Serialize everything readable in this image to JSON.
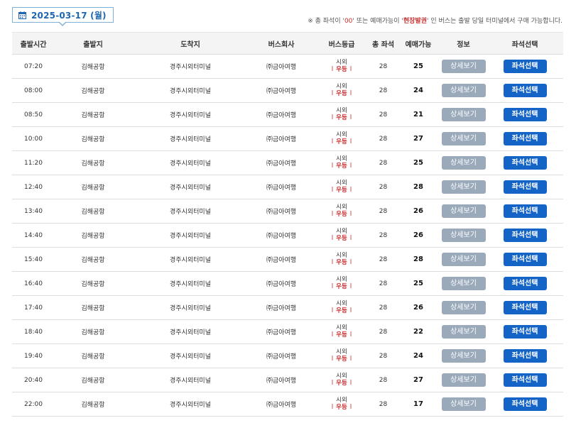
{
  "header": {
    "date": "2025-03-17 (월)",
    "notice_prefix": "※ 총 좌석이 '",
    "notice_zero": "00",
    "notice_middle": "' 또는 예매가능이 '",
    "notice_site": "현장발권",
    "notice_suffix": "' 인 버스는 출발 당일 터미널에서 구매 가능합니다."
  },
  "columns": [
    "출발시간",
    "출발지",
    "도착지",
    "버스회사",
    "버스등급",
    "총 좌석",
    "예매가능",
    "정보",
    "좌석선택"
  ],
  "grade_icon": "shiwoe-premium-grade-icon",
  "colors": {
    "accent": "#1464c8",
    "detail_button": "#9aaabb",
    "notice_highlight": "#cc2d2d"
  },
  "buttons": {
    "detail": "상세보기",
    "seat": "좌석선택"
  },
  "rows": [
    {
      "time": "07:20",
      "origin": "김해공항",
      "destination": "경주시외터미널",
      "company": "㈜금아여행",
      "grade": "시외우등",
      "total": "28",
      "available": "25"
    },
    {
      "time": "08:00",
      "origin": "김해공항",
      "destination": "경주시외터미널",
      "company": "㈜금아여행",
      "grade": "시외우등",
      "total": "28",
      "available": "24"
    },
    {
      "time": "08:50",
      "origin": "김해공항",
      "destination": "경주시외터미널",
      "company": "㈜금아여행",
      "grade": "시외우등",
      "total": "28",
      "available": "21"
    },
    {
      "time": "10:00",
      "origin": "김해공항",
      "destination": "경주시외터미널",
      "company": "㈜금아여행",
      "grade": "시외우등",
      "total": "28",
      "available": "27"
    },
    {
      "time": "11:20",
      "origin": "김해공항",
      "destination": "경주시외터미널",
      "company": "㈜금아여행",
      "grade": "시외우등",
      "total": "28",
      "available": "25"
    },
    {
      "time": "12:40",
      "origin": "김해공항",
      "destination": "경주시외터미널",
      "company": "㈜금아여행",
      "grade": "시외우등",
      "total": "28",
      "available": "28"
    },
    {
      "time": "13:40",
      "origin": "김해공항",
      "destination": "경주시외터미널",
      "company": "㈜금아여행",
      "grade": "시외우등",
      "total": "28",
      "available": "26"
    },
    {
      "time": "14:40",
      "origin": "김해공항",
      "destination": "경주시외터미널",
      "company": "㈜금아여행",
      "grade": "시외우등",
      "total": "28",
      "available": "26"
    },
    {
      "time": "15:40",
      "origin": "김해공항",
      "destination": "경주시외터미널",
      "company": "㈜금아여행",
      "grade": "시외우등",
      "total": "28",
      "available": "28"
    },
    {
      "time": "16:40",
      "origin": "김해공항",
      "destination": "경주시외터미널",
      "company": "㈜금아여행",
      "grade": "시외우등",
      "total": "28",
      "available": "25"
    },
    {
      "time": "17:40",
      "origin": "김해공항",
      "destination": "경주시외터미널",
      "company": "㈜금아여행",
      "grade": "시외우등",
      "total": "28",
      "available": "26"
    },
    {
      "time": "18:40",
      "origin": "김해공항",
      "destination": "경주시외터미널",
      "company": "㈜금아여행",
      "grade": "시외우등",
      "total": "28",
      "available": "22"
    },
    {
      "time": "19:40",
      "origin": "김해공항",
      "destination": "경주시외터미널",
      "company": "㈜금아여행",
      "grade": "시외우등",
      "total": "28",
      "available": "24"
    },
    {
      "time": "20:40",
      "origin": "김해공항",
      "destination": "경주시외터미널",
      "company": "㈜금아여행",
      "grade": "시외우등",
      "total": "28",
      "available": "27"
    },
    {
      "time": "22:00",
      "origin": "김해공항",
      "destination": "경주시외터미널",
      "company": "㈜금아여행",
      "grade": "시외우등",
      "total": "28",
      "available": "17"
    }
  ]
}
